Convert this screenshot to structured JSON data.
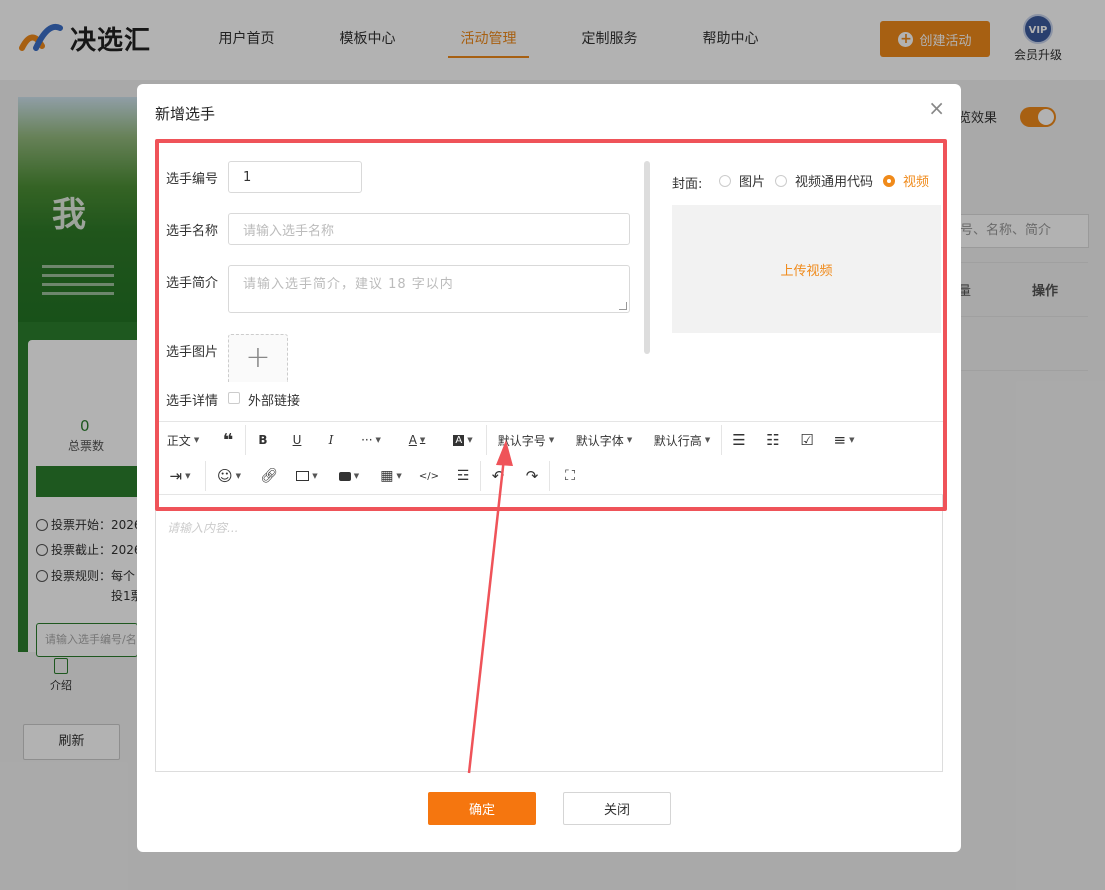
{
  "header": {
    "logo_text": "决选汇",
    "nav": [
      "用户首页",
      "模板中心",
      "活动管理",
      "定制服务",
      "帮助中心"
    ],
    "nav_active_index": 2,
    "create_label": "创建活动",
    "vip_badge": "VIP",
    "vip_label": "会员升级"
  },
  "background": {
    "stat_num": "0",
    "stat_label": "总票数",
    "info_start": "投票开始：2026",
    "info_end": "投票截止：2026",
    "info_rule": "投票规则：每个",
    "info_rule2": "投1票",
    "search_placeholder": "请输入选手编号/名",
    "tab_intro": "介绍",
    "refresh": "刷新",
    "preview_label": "览效果",
    "right_search": "号、名称、简介",
    "right_col_a": "量",
    "right_col_op": "操作"
  },
  "modal": {
    "title": "新增选手",
    "close_icon": "×",
    "labels": {
      "number": "选手编号",
      "name": "选手名称",
      "intro": "选手简介",
      "image": "选手图片",
      "detail": "选手详情"
    },
    "number_value": "1",
    "name_placeholder": "请输入选手名称",
    "intro_placeholder": "请输入选手简介，建议 18 字以内",
    "upload_plus": "+",
    "external_link": "外部链接",
    "cover_label": "封面:",
    "cover_options": [
      "图片",
      "视频通用代码",
      "视频"
    ],
    "cover_selected": 2,
    "upload_video": "上传视频",
    "editor_placeholder": "请输入内容...",
    "ok_label": "确定",
    "close_label": "关闭"
  },
  "toolbar": {
    "paragraph": "正文",
    "font_size": "默认字号",
    "font_family": "默认字体",
    "line_height": "默认行高"
  },
  "colors": {
    "accent": "#f08a1a",
    "highlight": "#ef5359",
    "green": "#2b7f2d"
  }
}
